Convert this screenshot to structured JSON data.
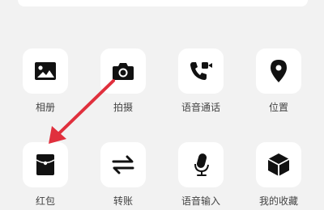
{
  "panel": {
    "items": [
      {
        "label": "相册",
        "icon": "gallery-icon"
      },
      {
        "label": "拍摄",
        "icon": "camera-icon"
      },
      {
        "label": "语音通话",
        "icon": "voice-video-call-icon"
      },
      {
        "label": "位置",
        "icon": "location-icon"
      },
      {
        "label": "红包",
        "icon": "red-packet-icon"
      },
      {
        "label": "转账",
        "icon": "transfer-icon"
      },
      {
        "label": "语音输入",
        "icon": "microphone-icon"
      },
      {
        "label": "我的收藏",
        "icon": "favorites-icon"
      }
    ]
  },
  "annotation": {
    "icon": "pointer-arrow",
    "color": "#e0303d"
  }
}
